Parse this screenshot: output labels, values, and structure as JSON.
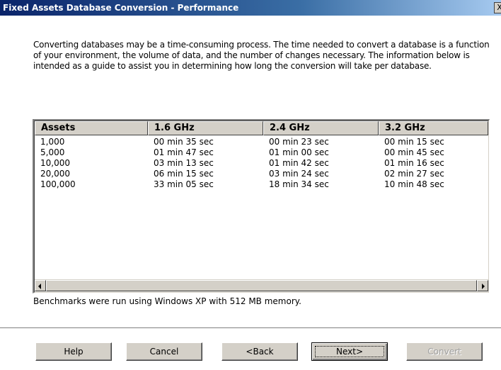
{
  "window": {
    "title": "Fixed Assets Database Conversion - Performance",
    "close_glyph": "X"
  },
  "intro": "Converting databases may be a time-consuming process. The time needed to convert a database is a function of your environment, the volume of data, and the number of changes necessary. The information below is intended as a guide to assist you in determining how long the conversion will take per database.",
  "table": {
    "headers": [
      "Assets",
      "1.6 GHz",
      "2.4 GHz",
      "3.2 GHz"
    ],
    "rows": [
      [
        "1,000",
        "00 min 35 sec",
        "00 min 23 sec",
        "00 min 15 sec"
      ],
      [
        "5,000",
        "01 min 47 sec",
        "01 min 00 sec",
        "00 min 45 sec"
      ],
      [
        "10,000",
        "03 min 13 sec",
        "01 min 42 sec",
        "01 min 16 sec"
      ],
      [
        "20,000",
        "06 min 15 sec",
        "03 min 24 sec",
        "02 min 27 sec"
      ],
      [
        "100,000",
        "33 min 05 sec",
        "18 min 34 sec",
        "10 min 48 sec"
      ]
    ]
  },
  "benchmark_note": "Benchmarks were run using Windows XP with 512 MB memory.",
  "buttons": {
    "help": "Help",
    "cancel": "Cancel",
    "back": "<Back",
    "next": "Next>",
    "convert": "Convert"
  },
  "scroll_icons": {
    "left": "scroll-left-arrow-icon",
    "right": "scroll-right-arrow-icon"
  }
}
